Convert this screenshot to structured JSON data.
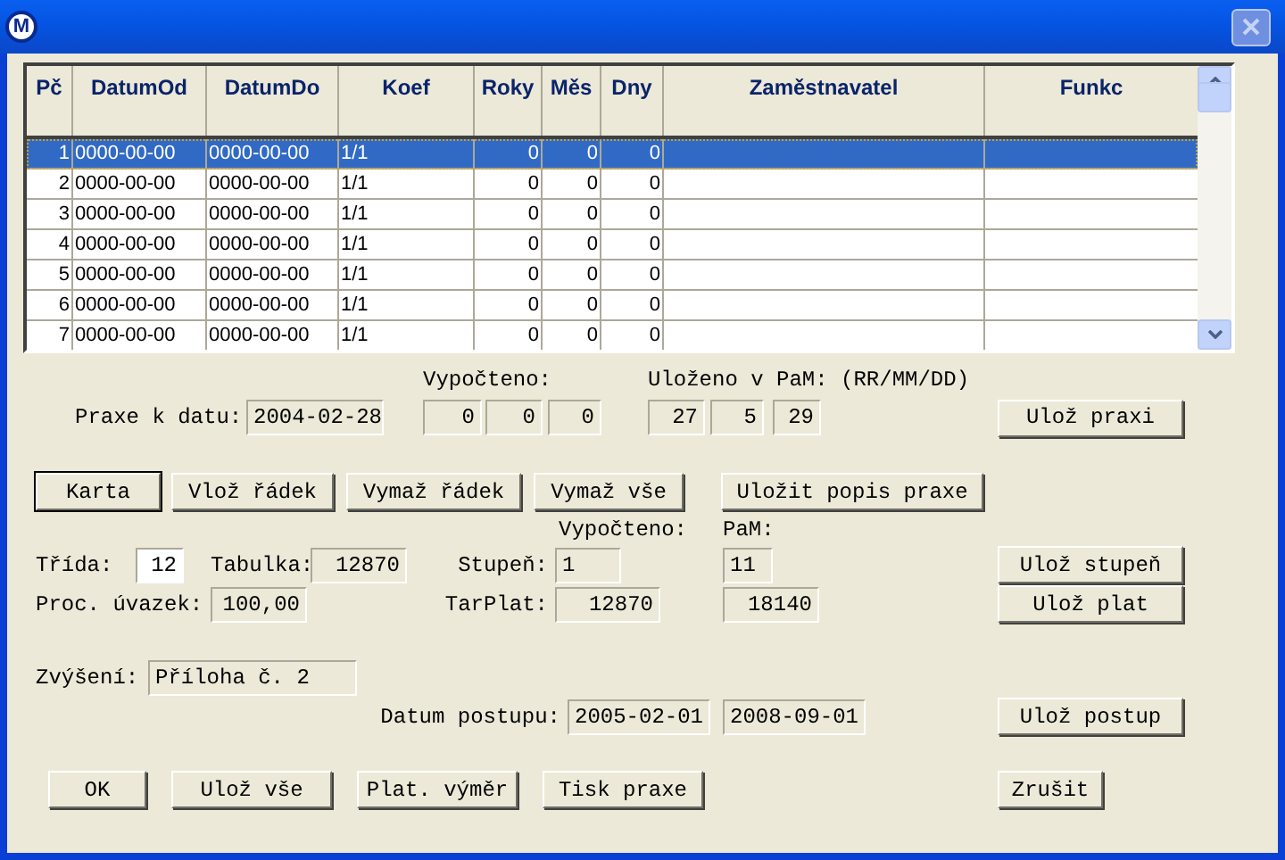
{
  "window": {
    "logo": "M"
  },
  "table": {
    "columns": [
      "Pč",
      "DatumOd",
      "DatumDo",
      "Koef",
      "Roky",
      "Měs",
      "Dny",
      "Zaměstnavatel",
      "Funkc"
    ],
    "rows": [
      {
        "selected": true,
        "cells": [
          "1",
          "0000-00-00",
          "0000-00-00",
          "1/1",
          "0",
          "0",
          "0",
          "",
          ""
        ]
      },
      {
        "selected": false,
        "cells": [
          "2",
          "0000-00-00",
          "0000-00-00",
          "1/1",
          "0",
          "0",
          "0",
          "",
          ""
        ]
      },
      {
        "selected": false,
        "cells": [
          "3",
          "0000-00-00",
          "0000-00-00",
          "1/1",
          "0",
          "0",
          "0",
          "",
          ""
        ]
      },
      {
        "selected": false,
        "cells": [
          "4",
          "0000-00-00",
          "0000-00-00",
          "1/1",
          "0",
          "0",
          "0",
          "",
          ""
        ]
      },
      {
        "selected": false,
        "cells": [
          "5",
          "0000-00-00",
          "0000-00-00",
          "1/1",
          "0",
          "0",
          "0",
          "",
          ""
        ]
      },
      {
        "selected": false,
        "cells": [
          "6",
          "0000-00-00",
          "0000-00-00",
          "1/1",
          "0",
          "0",
          "0",
          "",
          ""
        ]
      },
      {
        "selected": false,
        "cells": [
          "7",
          "0000-00-00",
          "0000-00-00",
          "1/1",
          "0",
          "0",
          "0",
          "",
          ""
        ]
      }
    ]
  },
  "praxe": {
    "computed_label": "Vypočteno:",
    "saved_label": "Uloženo v PaM: (RR/MM/DD)",
    "date_label": "Praxe k datu:",
    "date": "2004-02-28",
    "computed": [
      "0",
      "0",
      "0"
    ],
    "saved": [
      "27",
      "5",
      "29"
    ],
    "save_button": "Ulož praxi"
  },
  "row_buttons": [
    {
      "label": "Karta",
      "default": true
    },
    {
      "label": "Vlož řádek",
      "default": false
    },
    {
      "label": "Vymaž řádek",
      "default": false
    },
    {
      "label": "Vymaž vše",
      "default": false
    },
    {
      "label": "Uložit popis praxe",
      "default": false
    }
  ],
  "salary": {
    "computed_label": "Vypočteno:",
    "pam_label": "PaM:",
    "trida_label": "Třída:",
    "trida": "12",
    "tabulka_label": "Tabulka:",
    "tabulka": "12870",
    "stupen_label": "Stupeň:",
    "stupen": "1",
    "stupen_pam": "11",
    "stupen_button": "Ulož stupeň",
    "uvazek_label": "Proc. úvazek:",
    "uvazek": "100,00",
    "tarplat_label": "TarPlat:",
    "tarplat": "12870",
    "tarplat_pam": "18140",
    "plat_button": "Ulož plat"
  },
  "zvyseni": {
    "label": "Zvýšení:",
    "value": "Příloha č. 2"
  },
  "postup": {
    "label": "Datum postupu:",
    "computed": "2005-02-01",
    "pam": "2008-09-01",
    "button": "Ulož postup"
  },
  "bottom_buttons": [
    "OK",
    "Ulož vše",
    "Plat. výměr",
    "Tisk praxe"
  ],
  "cancel_button": "Zrušit"
}
